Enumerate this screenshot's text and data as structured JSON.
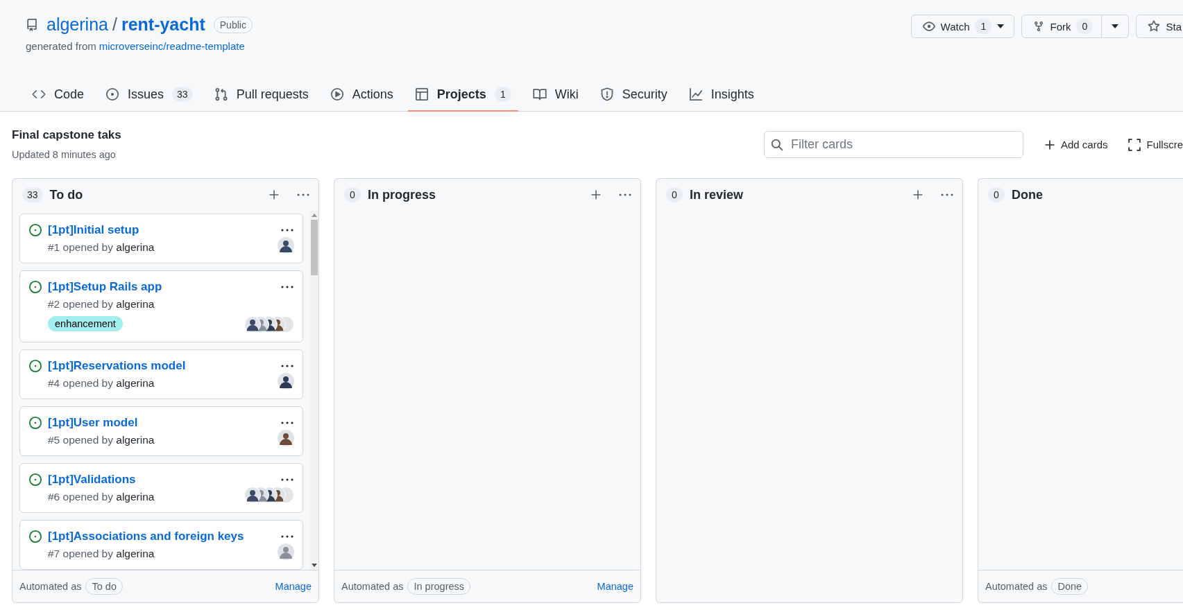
{
  "repo": {
    "owner": "algerina",
    "separator": "/",
    "name": "rent-yacht",
    "visibility": "Public",
    "generated_prefix": "generated from",
    "template": "microverseinc/readme-template"
  },
  "actions": [
    {
      "kind": "watch",
      "label": "Watch",
      "count": "1"
    },
    {
      "kind": "fork",
      "label": "Fork",
      "count": "0"
    },
    {
      "kind": "star",
      "label": "Sta"
    }
  ],
  "tabs": [
    {
      "label": "Code",
      "selected": false
    },
    {
      "label": "Issues",
      "count": "33",
      "selected": false
    },
    {
      "label": "Pull requests",
      "selected": false
    },
    {
      "label": "Actions",
      "selected": false
    },
    {
      "label": "Projects",
      "count": "1",
      "selected": true
    },
    {
      "label": "Wiki",
      "selected": false
    },
    {
      "label": "Security",
      "selected": false
    },
    {
      "label": "Insights",
      "selected": false
    }
  ],
  "project": {
    "title": "Final capstone taks",
    "updated": "Updated 8 minutes ago"
  },
  "filter": {
    "placeholder": "Filter cards"
  },
  "tools": [
    {
      "kind": "add",
      "label": "Add cards"
    },
    {
      "kind": "fullscreen",
      "label": "Fullscre"
    }
  ],
  "columns": [
    {
      "count": "33",
      "name": "To do",
      "automated_prefix": "Automated as",
      "automation": "To do",
      "manage": "Manage",
      "cards": [
        {
          "title": "[1pt]Initial setup",
          "meta": "#1 opened by",
          "author": "algerina",
          "assignees": [
            {
              "kind": "picture"
            }
          ]
        },
        {
          "title": "[1pt]Setup Rails app",
          "meta": "#2 opened by",
          "author": "algerina",
          "labels": [
            {
              "name": "enhancement",
              "color": "#a2eeef"
            }
          ],
          "assignees": [
            {
              "kind": "picture"
            },
            {
              "kind": "picture"
            },
            {
              "kind": "picture"
            },
            {
              "kind": "picture"
            },
            {
              "kind": "picture"
            }
          ]
        },
        {
          "title": "[1pt]Reservations model",
          "meta": "#4 opened by",
          "author": "algerina",
          "assignees": [
            {
              "kind": "picture"
            }
          ]
        },
        {
          "title": "[1pt]User model",
          "meta": "#5 opened by",
          "author": "algerina",
          "assignees": [
            {
              "kind": "picture"
            }
          ]
        },
        {
          "title": "[1pt]Validations",
          "meta": "#6 opened by",
          "author": "algerina",
          "assignees": [
            {
              "kind": "picture"
            },
            {
              "kind": "picture"
            },
            {
              "kind": "picture"
            },
            {
              "kind": "picture"
            },
            {
              "kind": "picture"
            }
          ]
        },
        {
          "title": "[1pt]Associations and foreign keys",
          "meta": "#7 opened by",
          "author": "algerina",
          "assignees": [
            {
              "kind": "picture"
            }
          ]
        }
      ]
    },
    {
      "count": "0",
      "name": "In progress",
      "automated_prefix": "Automated as",
      "automation": "In progress",
      "manage": "Manage"
    },
    {
      "count": "0",
      "name": "In review"
    },
    {
      "count": "0",
      "name": "Done",
      "automated_prefix": "Automated as",
      "automation": "Done"
    }
  ]
}
